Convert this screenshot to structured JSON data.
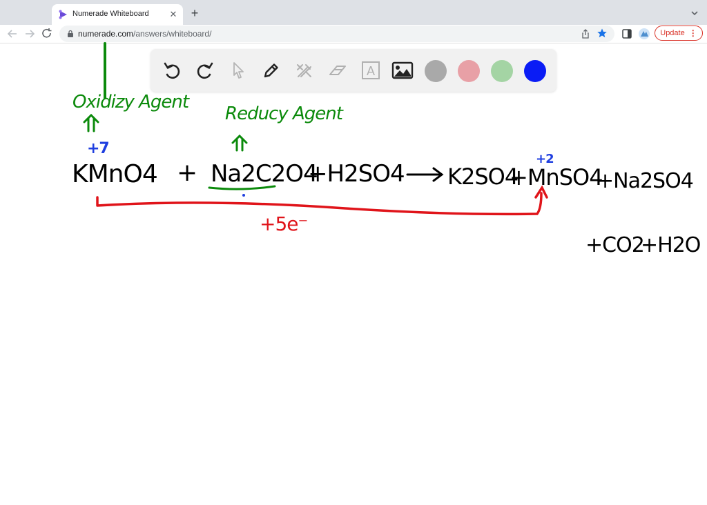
{
  "browser": {
    "tab_title": "Numerade Whiteboard",
    "url_host": "numerade.com",
    "url_path": "/answers/whiteboard/",
    "update_label": "Update",
    "update_more": "⋮"
  },
  "whiteboard": {
    "tools": [
      "undo-icon",
      "redo-icon",
      "pointer-icon",
      "pen-icon",
      "tools-icon",
      "eraser-icon",
      "text-icon",
      "image-icon"
    ],
    "text_tool_glyph": "A",
    "colors": {
      "gray": "#a9a9a9",
      "pink": "#e8a0a6",
      "green": "#a4d4a4",
      "blue": "#0a1cf5",
      "ink_black": "#000000",
      "ink_green": "#0b8a0b",
      "ink_red": "#e0141a",
      "ink_blue": "#1f3fe0"
    },
    "annotations": {
      "oxidizing_agent": "Oxidizy Agent",
      "reducing_agent": "Reducy Agent",
      "ox_state_mn_left": "+7",
      "ox_state_mn_right": "+2",
      "electron_transfer": "+5e⁻"
    },
    "equation": {
      "kmno4": "KMnO4",
      "plus1": "+",
      "na2c2o4": "Na2C2O4",
      "h2so4": "+H2SO4",
      "arrow": "⟶",
      "k2so4": "K2SO4",
      "mnso4": "+MnSO4",
      "na2so4": "+Na2SO4",
      "co2": "+CO2",
      "h2o": "+H2O"
    }
  }
}
